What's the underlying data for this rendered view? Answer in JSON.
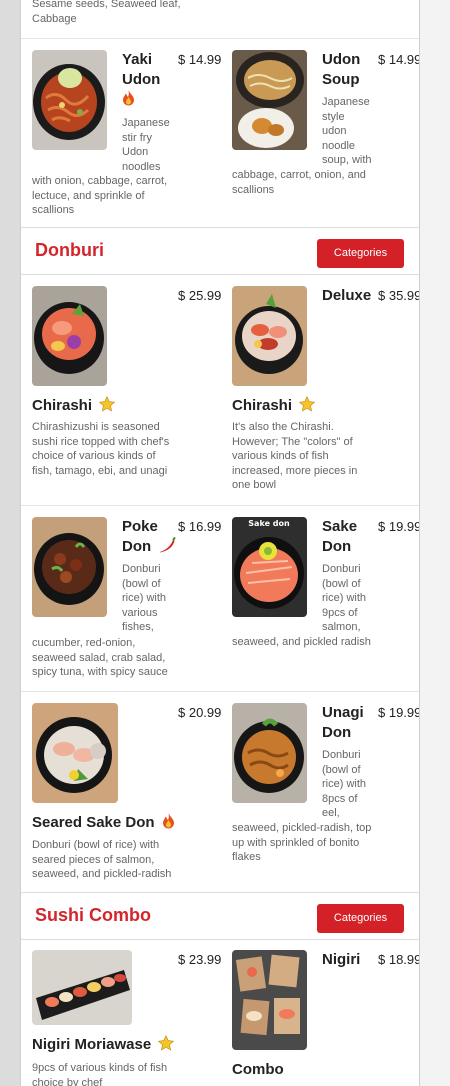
{
  "top_item": {
    "desc_tail": "Sesame seeds, Seaweed leaf, Cabbage"
  },
  "ramen_row": [
    {
      "name_lines": [
        "Yaki",
        "Udon"
      ],
      "price": "$ 14.99",
      "icon": "fire-icon",
      "desc_lines": [
        "Japanese",
        "stir fry",
        "Udon",
        "noodles",
        "with onion, cabbage, carrot,",
        "lectuce, and sprinkle of",
        "scallions"
      ]
    },
    {
      "name_lines": [
        "Udon",
        "Soup"
      ],
      "price": "$ 14.99",
      "icon": "",
      "desc_lines": [
        "Japanese",
        "style",
        "udon",
        "noodle",
        "soup, with",
        "cabbage, carrot, onion, and",
        "scallions"
      ]
    }
  ],
  "sections": {
    "donburi": {
      "title": "Donburi",
      "button": "Categories"
    },
    "sushi_combo": {
      "title": "Sushi Combo",
      "button": "Categories"
    }
  },
  "donburi_items": [
    {
      "name": "Chirashi",
      "price": "$ 25.99",
      "icon": "star-icon",
      "desc_lines": [
        "Chirashizushi is seasoned",
        "sushi rice topped with chef's",
        "choice of various kinds of",
        "fish, tamago, ebi, and unagi"
      ]
    },
    {
      "name_top": "Deluxe",
      "name": "Chirashi",
      "price": "$ 35.99",
      "icon": "star-icon",
      "desc_lines": [
        "It's also the Chirashi.",
        "However; The \"colors\" of",
        "various kinds of fish",
        "increased, more pieces in",
        "one bowl"
      ]
    },
    {
      "name_lines": [
        "Poke",
        "Don"
      ],
      "price": "$ 16.99",
      "icon": "chili-icon",
      "desc_lines": [
        "Donburi",
        "(bowl of",
        "rice) with",
        "various",
        "fishes,",
        "cucumber, red-onion,",
        "seaweed salad, crab salad,",
        "spicy tuna, with spicy sauce"
      ]
    },
    {
      "name_lines": [
        "Sake",
        "Don"
      ],
      "price": "$ 19.99",
      "icon": "",
      "image_text": "Sake don",
      "desc_lines": [
        "Donburi",
        "(bowl of",
        "rice) with",
        "9pcs of",
        "salmon,",
        "seaweed, and pickled radish"
      ]
    },
    {
      "name": "Seared Sake Don",
      "price": "$ 20.99",
      "icon": "fire-icon",
      "desc_lines": [
        "Donburi (bowl of rice) with",
        "seared pieces of salmon,",
        "seaweed, and pickled-radish"
      ]
    },
    {
      "name_lines": [
        "Unagi",
        "Don"
      ],
      "price": "$ 19.99",
      "icon": "",
      "desc_lines": [
        "Donburi",
        "(bowl of",
        "rice) with",
        "8pcs of",
        "eel,",
        "seaweed, pickled-radish, top",
        "up with sprinkled of bonito",
        "flakes"
      ]
    }
  ],
  "sushi_items": [
    {
      "name": "Nigiri Moriawase",
      "price": "$ 23.99",
      "icon": "star-icon",
      "desc_lines": [
        "9pcs of various kinds of fish",
        "choice by chef"
      ]
    },
    {
      "name_top": "Nigiri",
      "name": "Combo",
      "price": "$ 18.99",
      "icon": ""
    }
  ],
  "colors": {
    "accent": "#d42027",
    "title_red": "#d4252c",
    "text_dark": "#222222",
    "text_muted": "#666666"
  }
}
